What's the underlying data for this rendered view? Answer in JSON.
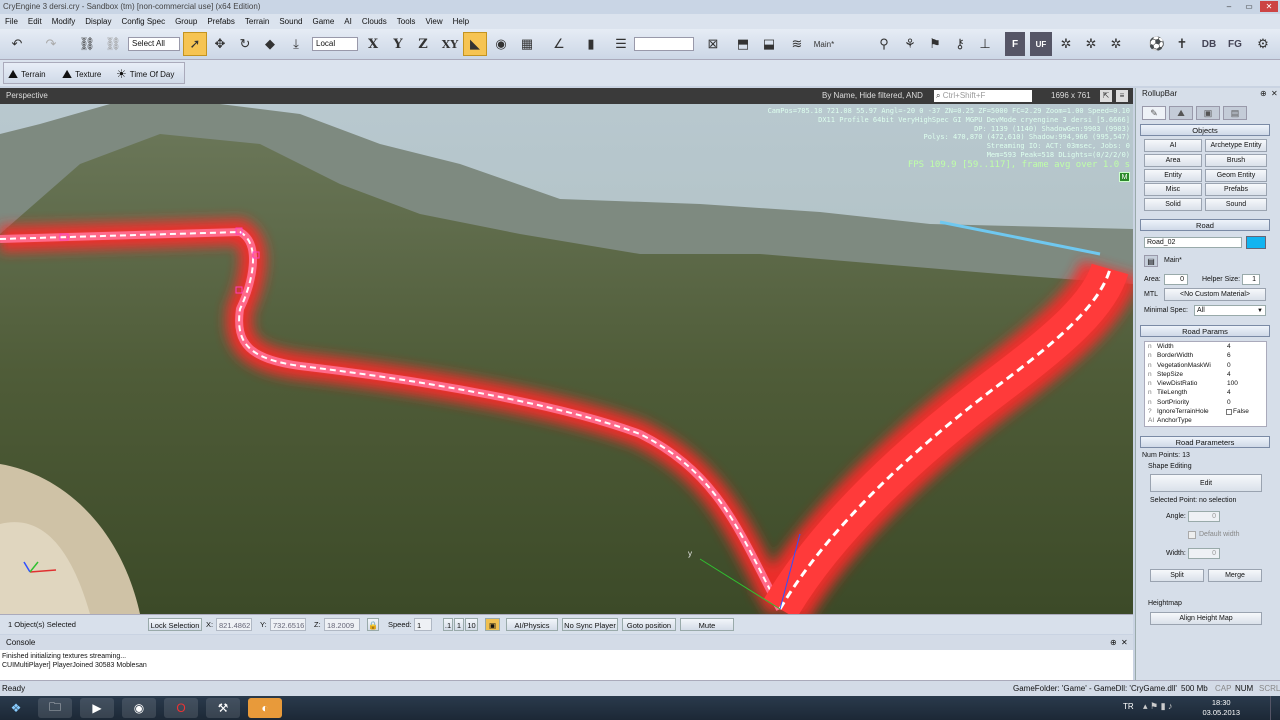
{
  "window": {
    "title": "CryEngine 3 dersi.cry - Sandbox (tm) [non-commercial use] (x64 Edition)"
  },
  "menu": [
    "File",
    "Edit",
    "Modify",
    "Display",
    "Config Spec",
    "Group",
    "Prefabs",
    "Terrain",
    "Sound",
    "Game",
    "AI",
    "Clouds",
    "Tools",
    "View",
    "Help"
  ],
  "toolbar": {
    "selection_filter": "Select All",
    "coord_system": "Local",
    "axis_x": "X",
    "axis_y": "Y",
    "axis_z": "Z",
    "axis_xy": "XY",
    "layer": "Main*"
  },
  "toolbar_icons_right": [
    "F",
    "UF",
    "DB",
    "FG"
  ],
  "toolbar2": {
    "terrain": "Terrain",
    "texture": "Texture",
    "time_of_day": "Time Of Day"
  },
  "viewport": {
    "name": "Perspective",
    "filter_text": "By Name, Hide filtered, AND",
    "search_placeholder": "Ctrl+Shift+F",
    "resolution": "1696 x 761",
    "hud_lines": [
      "CamPos=785.18 721.08 55.97 Angl=-20  0 -37 ZN=0.25 ZF=5000 FC=2.29 Zoom=1.00 Speed=0.10",
      "DX11 Profile 64bit VeryHighSpec GI MGPU DevMode cryengine 3 dersi [5.6666]",
      "DP: 1139 (1140) ShadowGen:9903 (9903)",
      "Polys: 470,870 (472,610) Shadow:994,966 (995,547)",
      "Streaming IO: ACT:  03msec, Jobs: 0",
      "Mem=593 Peak=518 DLights=(0/2/2/0)"
    ],
    "fps_line": "FPS 109.9 [59..117], frame avg over 1.0 s",
    "mode_badge": "M",
    "axis_label": "y"
  },
  "statusbar": {
    "selection": "1 Object(s) Selected",
    "lock_selection": "Lock Selection",
    "x_label": "X:",
    "x_value": "821.4862",
    "y_label": "Y:",
    "y_value": "732.6516",
    "z_label": "Z:",
    "z_value": "18.2009",
    "speed_label": "Speed:",
    "speed_value": "1",
    "speed_presets": [
      ".1",
      "1",
      "10"
    ],
    "ai_physics": "AI/Physics",
    "no_sync_player": "No Sync Player",
    "goto_position": "Goto position",
    "mute": "Mute"
  },
  "console": {
    "title": "Console",
    "lines": [
      "Finished initializing textures streaming...",
      "CUIMultiPlayer] PlayerJoined 30583 Moblesan"
    ]
  },
  "rollup": {
    "title": "RollupBar",
    "objects_title": "Objects",
    "object_buttons": [
      "AI",
      "Archetype Entity",
      "Area",
      "Brush",
      "Entity",
      "Geom Entity",
      "Misc",
      "Prefabs",
      "Solid",
      "Sound"
    ],
    "road_title": "Road",
    "road_name": "Road_02",
    "road_color": "#12b4f0",
    "layer": "Main*",
    "area_label": "Area:",
    "area_value": "0",
    "helper_label": "Helper Size:",
    "helper_value": "1",
    "mtl_label": "MTL",
    "mtl_value": "<No Custom Material>",
    "minspec_label": "Minimal Spec:",
    "minspec_value": "All",
    "params_title": "Road Params",
    "params": [
      {
        "icon": "n",
        "name": "Width",
        "value": "4"
      },
      {
        "icon": "n",
        "name": "BorderWidth",
        "value": "6"
      },
      {
        "icon": "n",
        "name": "VegetationMaskWi",
        "value": "0"
      },
      {
        "icon": "n",
        "name": "StepSize",
        "value": "4"
      },
      {
        "icon": "n",
        "name": "ViewDistRatio",
        "value": "100"
      },
      {
        "icon": "n",
        "name": "TileLength",
        "value": "4"
      },
      {
        "icon": "n",
        "name": "SortPriority",
        "value": "0"
      },
      {
        "icon": "?",
        "name": "IgnoreTerrainHole",
        "value": "False"
      },
      {
        "icon": "AI",
        "name": "AnchorType",
        "value": ""
      }
    ],
    "road_parameters_title": "Road Parameters",
    "num_points": "Num Points: 13",
    "shape_editing": "Shape Editing",
    "edit": "Edit",
    "selected_point": "Selected Point: no selection",
    "angle_label": "Angle:",
    "angle_value": "0",
    "default_width": "Default width",
    "width_label": "Width:",
    "width_value": "0",
    "split": "Split",
    "merge": "Merge",
    "heightmap": "Heightmap",
    "align_height_map": "Align Height Map"
  },
  "bottom": {
    "ready": "Ready",
    "gamefolder": "GameFolder: 'Game' - GameDll: 'CryGame.dll'",
    "mem": "500 Mb",
    "indicators": [
      "CAP",
      "NUM",
      "SCRL"
    ]
  },
  "taskbar": {
    "lang": "TR",
    "time": "18:30",
    "date": "03.05.2013"
  }
}
